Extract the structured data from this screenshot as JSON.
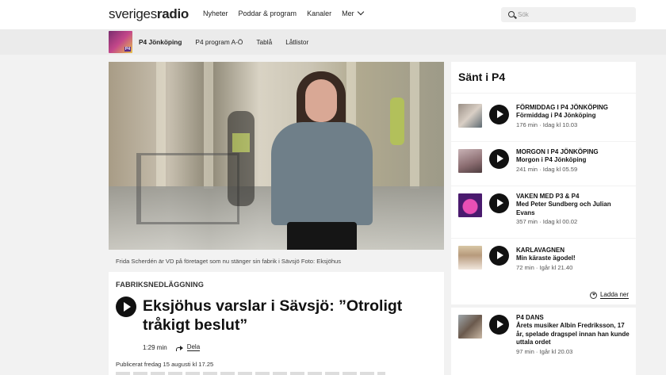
{
  "header": {
    "logo_text": "sveriges",
    "logo_mark": "radio",
    "nav": [
      "Nyheter",
      "Poddar & program",
      "Kanaler",
      "Mer"
    ],
    "search_placeholder": "Sök"
  },
  "subnav": {
    "channel": "P4 Jönköping",
    "items": [
      "P4 program A-Ö",
      "Tablå",
      "Låtlistor"
    ]
  },
  "article": {
    "caption": "Frida Scherdén är VD på företaget som nu stänger sin fabrik i Sävsjö Foto: Eksjöhus",
    "tag": "FABRIKSNEDLÄGGNING",
    "headline": "Eksjöhus varslar i Sävsjö: ”Otroligt tråkigt beslut”",
    "duration": "1:29 min",
    "share_label": "Dela",
    "published": "Publicerat fredag 15 augusti kl 17.25"
  },
  "sidebar": {
    "title": "Sänt i P4",
    "download_label": "Ladda ner",
    "episodes": [
      {
        "program": "FÖRMIDDAG I P4 JÖNKÖPING",
        "title": "Förmiddag i P4 Jönköping",
        "info": "176 min · Idag kl 10.03"
      },
      {
        "program": "MORGON I P4 JÖNKÖPING",
        "title": "Morgon i P4 Jönköping",
        "info": "241 min · Idag kl 05.59"
      },
      {
        "program": "VAKEN MED P3 & P4",
        "title": "Med Peter Sundberg och Julian Evans",
        "info": "357 min · Idag kl 00.02"
      },
      {
        "program": "KARLAVAGNEN",
        "title": "Min käraste ägodel!",
        "info": "72 min · Igår kl 21.40"
      },
      {
        "program": "P4 DANS",
        "title": "Årets musiker Albin Fredriksson, 17 år, spelade dragspel innan han kunde uttala ordet",
        "info": "97 min · Igår kl 20.03"
      }
    ]
  }
}
